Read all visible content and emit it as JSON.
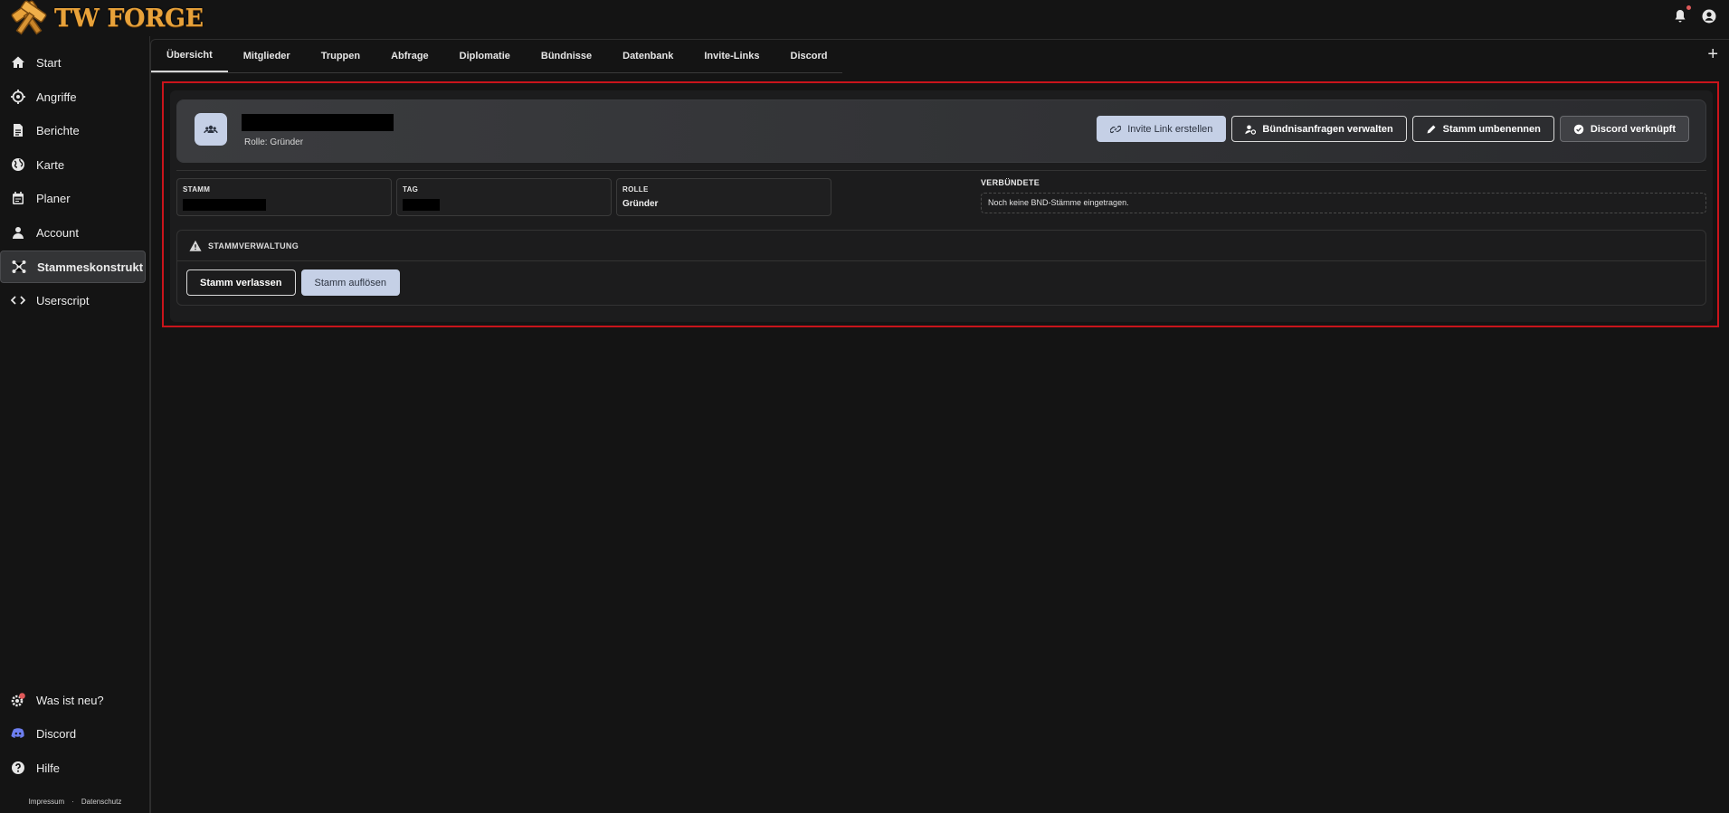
{
  "app": {
    "logo_text": "TW FORGE"
  },
  "sidebar": {
    "items": [
      {
        "label": "Start",
        "icon": "home-icon"
      },
      {
        "label": "Angriffe",
        "icon": "target-icon"
      },
      {
        "label": "Berichte",
        "icon": "document-icon"
      },
      {
        "label": "Karte",
        "icon": "globe-icon"
      },
      {
        "label": "Planer",
        "icon": "calendar-icon"
      },
      {
        "label": "Account",
        "icon": "user-icon"
      },
      {
        "label": "Stammeskonstrukt",
        "icon": "network-icon",
        "active": true
      },
      {
        "label": "Userscript",
        "icon": "code-icon"
      }
    ],
    "bottom_items": [
      {
        "label": "Was ist neu?",
        "icon": "gear-badge-icon",
        "badge": "1"
      },
      {
        "label": "Discord",
        "icon": "discord-icon"
      },
      {
        "label": "Hilfe",
        "icon": "help-icon"
      }
    ],
    "footer": {
      "impressum": "Impressum",
      "separator": "·",
      "datenschutz": "Datenschutz"
    }
  },
  "tabs": [
    "Übersicht",
    "Mitglieder",
    "Truppen",
    "Abfrage",
    "Diplomatie",
    "Bündnisse",
    "Datenbank",
    "Invite-Links",
    "Discord"
  ],
  "active_tab": "Übersicht",
  "plus_label": "+",
  "tribe": {
    "role_line": "Rolle: Gründer",
    "actions": {
      "invite": "Invite Link erstellen",
      "alliance": "Bündnisanfragen verwalten",
      "rename": "Stamm umbenennen",
      "discord": "Discord verknüpft"
    },
    "info": {
      "stamm_label": "STAMM",
      "tag_label": "TAG",
      "rolle_label": "ROLLE",
      "rolle_value": "Gründer",
      "allies_label": "VERBÜNDETE",
      "allies_empty": "Noch keine BND-Stämme eingetragen."
    },
    "admin": {
      "title": "STAMMVERWALTUNG",
      "leave": "Stamm verlassen",
      "dissolve": "Stamm auflösen"
    }
  },
  "colors": {
    "accent_light": "#c5d0e6",
    "highlight_frame": "#c9141b",
    "logo": "#e8a23a"
  }
}
